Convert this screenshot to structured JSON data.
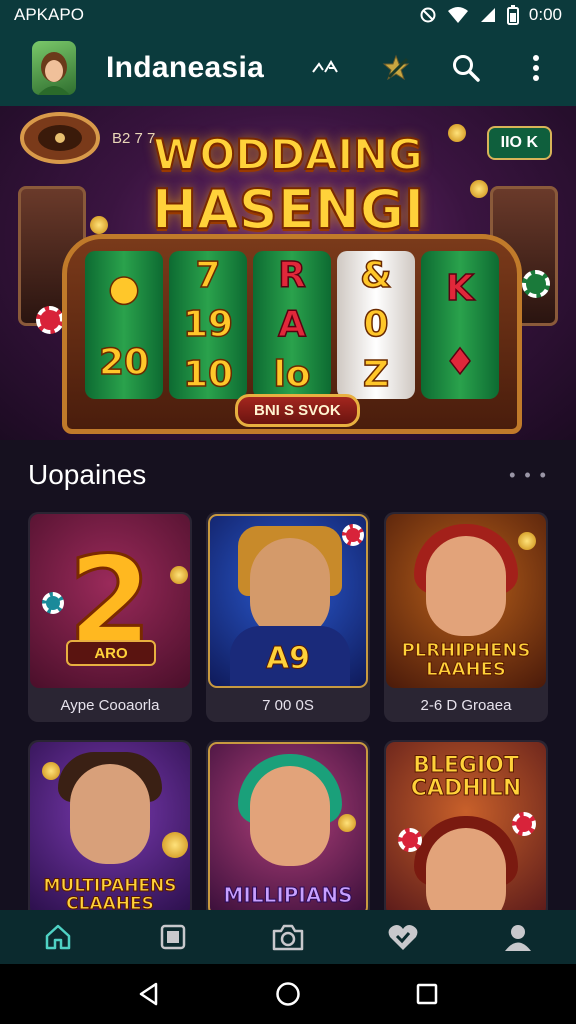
{
  "status_bar": {
    "left_text": "APKAPO",
    "time": "0:00",
    "icons": [
      "do-not-disturb-icon",
      "wifi-icon",
      "signal-icon",
      "battery-icon"
    ]
  },
  "app_bar": {
    "title": "Indaneasia",
    "actions": [
      {
        "name": "cast-icon",
        "glyph": "ᐞᐳ"
      },
      {
        "name": "star-edit-icon"
      },
      {
        "name": "search-icon"
      },
      {
        "name": "overflow-menu-icon"
      }
    ]
  },
  "hero": {
    "tag": "B2 7 7",
    "badge": "IIO K",
    "title_line1": "WODDAING",
    "title_line2": "HASENGI",
    "button": "BNI S SVOK",
    "reels": [
      {
        "symbols": [
          "20"
        ],
        "light": false
      },
      {
        "symbols": [
          "7",
          "19",
          "10"
        ],
        "light": false
      },
      {
        "symbols": [
          "R",
          "A",
          "lo"
        ],
        "light": false
      },
      {
        "symbols": [
          "&",
          "0",
          "Z"
        ],
        "light": true
      },
      {
        "symbols": [
          "K"
        ],
        "light": false
      }
    ]
  },
  "section": {
    "title": "Uopaines",
    "more": "• • •"
  },
  "games": [
    {
      "label": "Aype Cooaorla",
      "art_text": "2",
      "plate": "ARO",
      "theme": "number"
    },
    {
      "label": "7 00 0S",
      "art_text": "A9",
      "theme": "hero"
    },
    {
      "label": "2-6 D Groaea",
      "art_text": "PLRHIPHENS LAAHES",
      "theme": "woman-red"
    },
    {
      "label": "",
      "art_text": "MULTIPAHENS CLAAHES",
      "theme": "man"
    },
    {
      "label": "",
      "art_text": "MILLIPIANS",
      "theme": "woman-green"
    },
    {
      "label": "",
      "art_text": "BLEGIOT CADHILN",
      "theme": "woman-blonde"
    }
  ],
  "bottom_nav": [
    "home-icon",
    "stop-square-icon",
    "camera-icon",
    "heart-check-icon",
    "profile-icon"
  ],
  "system_nav": [
    "back-icon",
    "home-circle-icon",
    "recents-icon"
  ],
  "colors": {
    "app_bar": "#0b3b3d",
    "background": "#14101f",
    "accent_gold": "#ffd23a",
    "card": "#2a2533"
  }
}
